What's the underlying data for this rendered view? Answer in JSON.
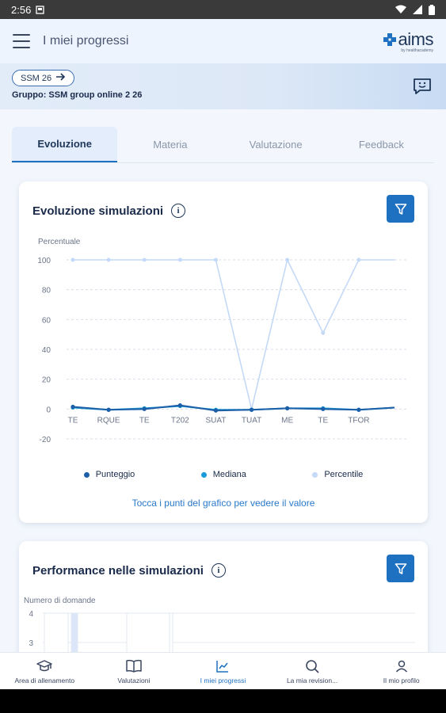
{
  "status": {
    "time": "2:56"
  },
  "app_bar": {
    "title": "I miei progressi",
    "logo_text": "aims",
    "logo_sub": "by healthacademy"
  },
  "banner": {
    "chip_label": "SSM 26",
    "group_text": "Gruppo: SSM group online 2 26"
  },
  "tabs": [
    {
      "label": "Evoluzione",
      "active": true
    },
    {
      "label": "Materia",
      "active": false
    },
    {
      "label": "Valutazione",
      "active": false
    },
    {
      "label": "Feedback",
      "active": false
    }
  ],
  "card1": {
    "title": "Evoluzione simulazioni",
    "hint": "Tocca i punti del grafico per vedere il valore"
  },
  "card2": {
    "title": "Performance nelle simulazioni"
  },
  "chart_data": [
    {
      "type": "line",
      "ylabel": "Percentuale",
      "ylim": [
        -20,
        100
      ],
      "yticks": [
        100,
        80,
        60,
        40,
        20,
        0,
        -20
      ],
      "categories": [
        "TE",
        "RQUE",
        "TE",
        "T202",
        "SUAT",
        "TUAT",
        "ME",
        "TE",
        "TFOR"
      ],
      "x_points": 10,
      "series": [
        {
          "name": "Punteggio",
          "color": "#1c5fa8",
          "values": [
            1.5,
            -0.5,
            0,
            2.5,
            -1,
            -0.5,
            0.5,
            0,
            -0.5,
            1
          ]
        },
        {
          "name": "Mediana",
          "color": "#1a9bd7",
          "values": [
            1,
            -0.5,
            0.5,
            2,
            -0.5,
            -0.5,
            0.5,
            0.5,
            -0.5,
            1
          ]
        },
        {
          "name": "Percentile",
          "color": "#c4d9f7",
          "values": [
            100,
            100,
            100,
            100,
            100,
            0,
            100,
            51,
            100,
            100
          ]
        }
      ],
      "grid": true,
      "legend": "bottom"
    },
    {
      "type": "bar",
      "ylabel": "Numero di domande",
      "yticks": [
        4,
        3
      ]
    }
  ],
  "bottom_nav": [
    {
      "label": "Area di allenamento",
      "icon": "graduation-cap-icon",
      "active": false
    },
    {
      "label": "Valutazioni",
      "icon": "book-icon",
      "active": false
    },
    {
      "label": "I miei progressi",
      "icon": "chart-icon",
      "active": true
    },
    {
      "label": "La mia revision...",
      "icon": "search-icon",
      "active": false
    },
    {
      "label": "Il mio profilo",
      "icon": "user-icon",
      "active": false
    }
  ],
  "colors": {
    "accent": "#1e70c0",
    "title": "#1a2a4a"
  }
}
